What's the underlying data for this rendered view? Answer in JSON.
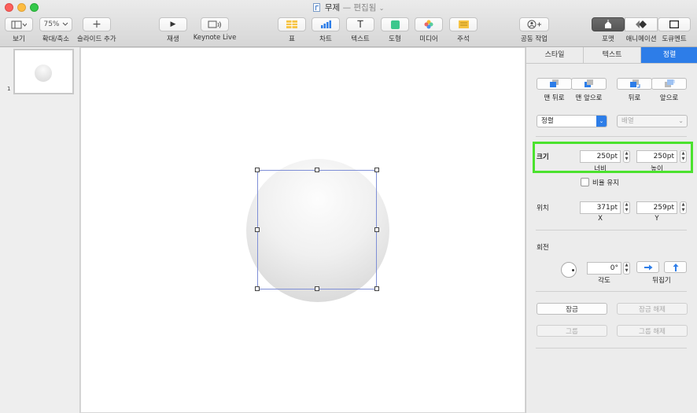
{
  "window": {
    "title": "무제",
    "edited_suffix": "— 편집됨",
    "title_chevron": "⌄"
  },
  "toolbar": {
    "view_label": "보기",
    "zoom_value": "75%",
    "zoom_label": "확대/축소",
    "add_slide_label": "슬라이드 추가",
    "play_label": "재생",
    "keynote_live_label": "Keynote Live",
    "table_label": "표",
    "chart_label": "차트",
    "text_label": "텍스트",
    "shape_label": "도형",
    "media_label": "미디어",
    "comment_label": "주석",
    "collaborate_label": "공동 작업",
    "format_label": "포맷",
    "animate_label": "애니메이션",
    "document_label": "도큐멘트",
    "text_icon_glyph": "T",
    "add_icon_glyph": "+",
    "play_icon_glyph": "▶"
  },
  "navigator": {
    "slide_number": "1"
  },
  "inspector": {
    "tabs": [
      "스타일",
      "텍스트",
      "정렬"
    ],
    "active_tab": "정렬",
    "back_label": "맨 뒤로",
    "front_label": "맨 앞으로",
    "backward_label": "뒤로",
    "forward_label": "앞으로",
    "align_popup": "정렬",
    "distribute_popup": "배열",
    "size_title": "크기",
    "width_value": "250pt",
    "height_value": "250pt",
    "width_label": "너비",
    "height_label": "높이",
    "constrain_label": "비율 유지",
    "position_title": "위치",
    "x_value": "371pt",
    "y_value": "259pt",
    "x_label": "X",
    "y_label": "Y",
    "rotate_title": "회전",
    "angle_value": "0°",
    "angle_label": "각도",
    "flip_label": "뒤집기",
    "lock_label": "잠금",
    "unlock_label": "잠금 해제",
    "group_label": "그룹",
    "ungroup_label": "그룹 해제",
    "stepper_up": "▲",
    "stepper_down": "▼",
    "popup_arrow": "⌄"
  },
  "colors": {
    "accent": "#2d7de8",
    "highlight": "#4be22e",
    "selection": "#7f8fd6"
  }
}
